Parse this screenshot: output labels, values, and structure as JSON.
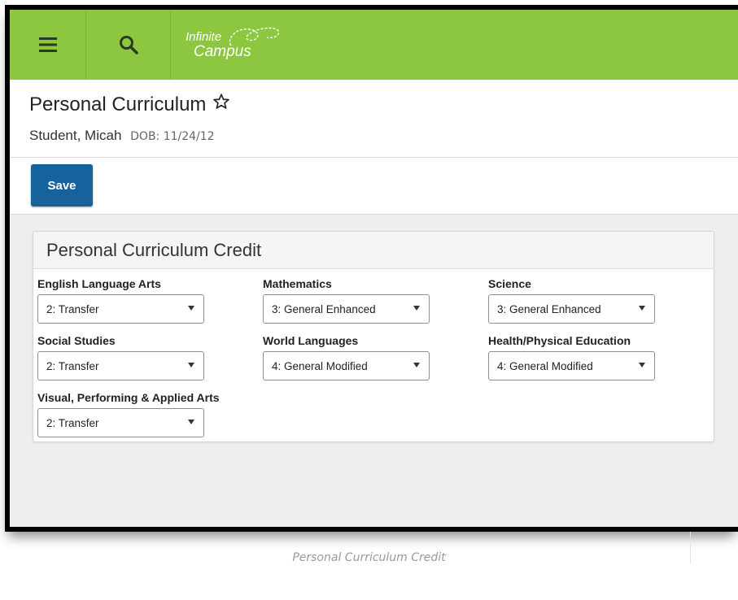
{
  "header": {
    "logo_line1": "Infinite",
    "logo_line2": "Campus",
    "brand_color": "#8dc63f",
    "menu_icon": "hamburger-icon",
    "search_icon": "search-icon"
  },
  "page": {
    "title": "Personal Curriculum",
    "student_name": "Student, Micah",
    "dob_label": "DOB: 11/24/12"
  },
  "toolbar": {
    "save_label": "Save",
    "save_color": "#16629c"
  },
  "card": {
    "title": "Personal Curriculum Credit",
    "fields": [
      {
        "label": "English Language Arts",
        "value": "2: Transfer"
      },
      {
        "label": "Mathematics",
        "value": "3: General Enhanced"
      },
      {
        "label": "Science",
        "value": "3: General Enhanced"
      },
      {
        "label": "Social Studies",
        "value": "2: Transfer"
      },
      {
        "label": "World Languages",
        "value": "4: General Modified"
      },
      {
        "label": "Health/Physical Education",
        "value": "4: General Modified"
      },
      {
        "label": "Visual, Performing & Applied Arts",
        "value": "2: Transfer"
      }
    ]
  },
  "caption": "Personal Curriculum Credit"
}
